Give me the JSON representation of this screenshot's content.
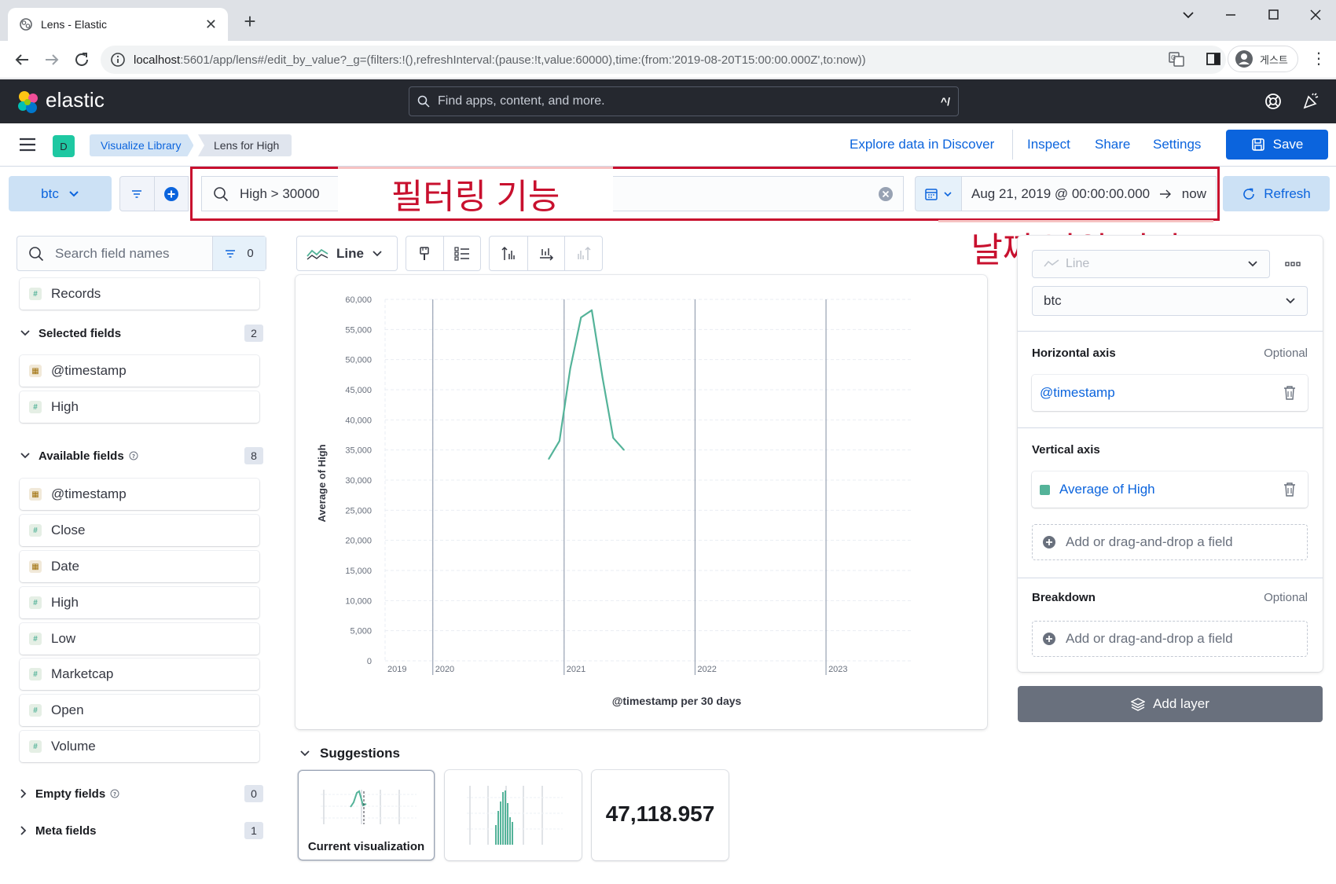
{
  "browser": {
    "tab_title": "Lens - Elastic",
    "url_host": "localhost",
    "url_rest": ":5601/app/lens#/edit_by_value?_g=(filters:!(),refreshInterval:(pause:!t,value:60000),time:(from:'2019-08-20T15:00:00.000Z',to:now))",
    "profile_label": "게스트"
  },
  "header": {
    "logo_text": "elastic",
    "search_placeholder": "Find apps, content, and more.",
    "search_shortcut": "^/"
  },
  "breadcrumbs": {
    "space_initial": "D",
    "items": [
      "Visualize Library",
      "Lens for High"
    ]
  },
  "toplinks": {
    "explore": "Explore data in Discover",
    "inspect": "Inspect",
    "share": "Share",
    "settings": "Settings",
    "save": "Save"
  },
  "querybar": {
    "data_view": "btc",
    "query": "High > 30000",
    "date_start": "Aug 21, 2019 @ 00:00:00.000",
    "date_end": "now",
    "refresh": "Refresh"
  },
  "annotations": {
    "filter": "필터링 기능",
    "date": "날짜 범위 변경"
  },
  "sidebar": {
    "search_placeholder": "Search field names",
    "filter_count": "0",
    "records": "Records",
    "selected": {
      "label": "Selected fields",
      "count": "2",
      "fields": [
        {
          "name": "@timestamp",
          "type": "date"
        },
        {
          "name": "High",
          "type": "number"
        }
      ]
    },
    "available": {
      "label": "Available fields",
      "count": "8",
      "fields": [
        {
          "name": "@timestamp",
          "type": "date"
        },
        {
          "name": "Close",
          "type": "number"
        },
        {
          "name": "Date",
          "type": "date"
        },
        {
          "name": "High",
          "type": "number"
        },
        {
          "name": "Low",
          "type": "number"
        },
        {
          "name": "Marketcap",
          "type": "number"
        },
        {
          "name": "Open",
          "type": "number"
        },
        {
          "name": "Volume",
          "type": "number"
        }
      ]
    },
    "empty": {
      "label": "Empty fields",
      "count": "0"
    },
    "meta": {
      "label": "Meta fields",
      "count": "1"
    }
  },
  "chart_toolbar": {
    "type_label": "Line"
  },
  "chart_data": {
    "type": "line",
    "xlabel": "@timestamp per 30 days",
    "ylabel": "Average of High",
    "ylim": [
      0,
      60000
    ],
    "yticks": [
      0,
      5000,
      10000,
      15000,
      20000,
      25000,
      30000,
      35000,
      40000,
      45000,
      50000,
      55000,
      60000
    ],
    "ytick_labels": [
      "0",
      "5,000",
      "10,000",
      "15,000",
      "20,000",
      "25,000",
      "30,000",
      "35,000",
      "40,000",
      "45,000",
      "50,000",
      "55,000",
      "60,000"
    ],
    "xlim": [
      "2019-08-21",
      "2023-09-01"
    ],
    "xticks": [
      "2019-08-21",
      "2020-01-01",
      "2021-01-01",
      "2022-01-01",
      "2023-01-01"
    ],
    "xtick_labels": [
      "2019",
      "2020",
      "2021",
      "2022",
      "2023"
    ],
    "year_markers": [
      "2020-01-01",
      "2021-01-01",
      "2022-01-01",
      "2023-01-01"
    ],
    "color": "#54b399",
    "grid": true,
    "x": [
      "2020-11-19",
      "2020-12-19",
      "2021-01-18",
      "2021-02-17",
      "2021-03-19",
      "2021-04-18",
      "2021-05-18",
      "2021-06-17"
    ],
    "values": [
      33500,
      36500,
      48500,
      57000,
      58200,
      47000,
      37000,
      35000
    ]
  },
  "suggestions": {
    "title": "Suggestions",
    "current_label": "Current visualization",
    "metric_value": "47,118.957"
  },
  "config": {
    "layer_type": "Line",
    "index": "btc",
    "horizontal": {
      "label": "Horizontal axis",
      "optional": "Optional",
      "field": "@timestamp"
    },
    "vertical": {
      "label": "Vertical axis",
      "field": "Average of High",
      "add": "Add or drag-and-drop a field"
    },
    "breakdown": {
      "label": "Breakdown",
      "optional": "Optional",
      "add": "Add or drag-and-drop a field"
    },
    "add_layer": "Add layer"
  }
}
